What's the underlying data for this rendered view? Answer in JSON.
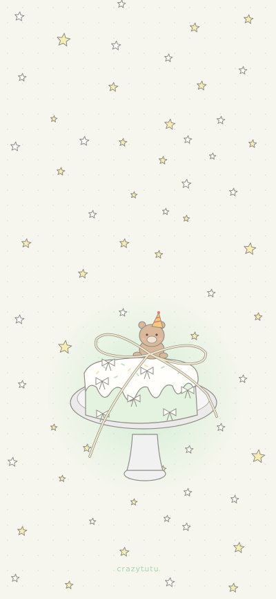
{
  "wallpaper": {
    "signature": "crazytutu",
    "colors": {
      "background": "#f7f6ee",
      "glow": "#c4ebcc",
      "star_yellow": "#f7edb0",
      "star_white": "#ffffff",
      "outline": "#8f8c86",
      "cake_frosting": "#e3f3df",
      "cake_icing": "#fffefa",
      "bear": "#d9b99a",
      "ribbon": "#efe6c9",
      "plate": "#eceaea"
    },
    "icons": [
      "star-icon",
      "cake-icon",
      "bear-icon",
      "party-hat-icon",
      "ribbon-bow-icon"
    ]
  }
}
